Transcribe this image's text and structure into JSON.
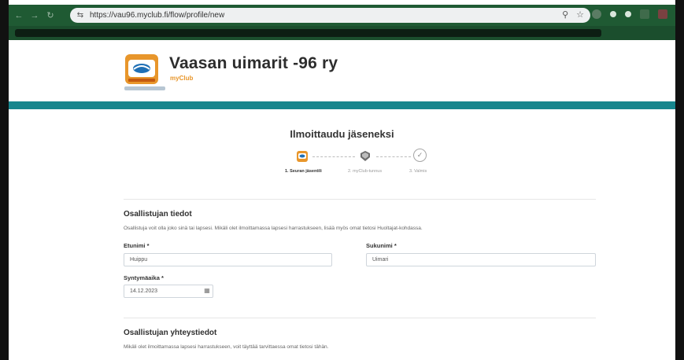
{
  "browser": {
    "url": "https://vau96.myclub.fi/flow/profile/new",
    "nav_icons": [
      "back-icon",
      "forward-icon",
      "reload-icon"
    ],
    "omnibox_icons": [
      "zoom-icon",
      "star-icon"
    ]
  },
  "club": {
    "name": "Vaasan uimarit -96 ry",
    "platform": "myClub"
  },
  "page": {
    "title": "Ilmoittaudu jäseneksi"
  },
  "steps": [
    {
      "label": "1. Seuran jäsentili",
      "state": "active",
      "icon": "club-logo-icon"
    },
    {
      "label": "2. myClub-tunnus",
      "state": "pending",
      "icon": "myclub-badge-icon"
    },
    {
      "label": "3. Valmis",
      "state": "pending",
      "icon": "check-icon"
    }
  ],
  "participant": {
    "heading": "Osallistujan tiedot",
    "description": "Osallistuja voit olla joko sinä tai lapsesi. Mikäli olet ilmoittamassa lapsesi harrastukseen, lisää myös omat tietosi Huoltajat-kohdassa.",
    "first_name_label": "Etunimi *",
    "first_name_value": "Huippu",
    "last_name_label": "Sukunimi *",
    "last_name_value": "Uimari",
    "birthdate_label": "Syntymäaika *",
    "birthdate_value": "14.12.2023"
  },
  "contact": {
    "heading": "Osallistujan yhteystiedot",
    "description": "Mikäli olet ilmoittamassa lapsesi harrastukseen, voit täyttää tarvittaessa omat tietosi tähän."
  },
  "colors": {
    "browser_chrome": "#1f5a33",
    "teal_band": "#17868d",
    "brand_orange": "#e8962b"
  }
}
